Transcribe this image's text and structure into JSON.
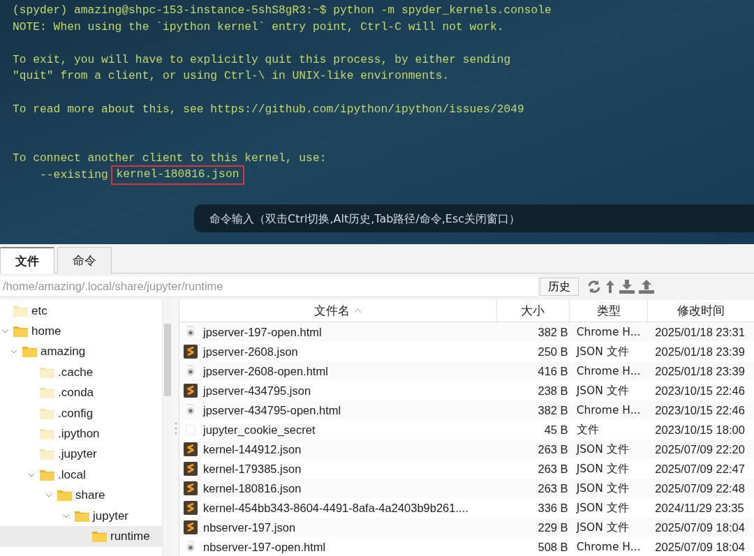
{
  "terminal": {
    "lines": [
      {
        "kind": "text",
        "text": "(spyder) amazing@shpc-153-instance-5shS8gR3:~$ python -m spyder_kernels.console"
      },
      {
        "kind": "text",
        "text": "NOTE: When using the `ipython kernel` entry point, Ctrl-C will not work."
      },
      {
        "kind": "blank"
      },
      {
        "kind": "text",
        "text": "To exit, you will have to explicitly quit this process, by either sending"
      },
      {
        "kind": "text",
        "text": "\"quit\" from a client, or using Ctrl-\\ in UNIX-like environments."
      },
      {
        "kind": "blank"
      },
      {
        "kind": "text",
        "text": "To read more about this, see https://github.com/ipython/ipython/issues/2049"
      },
      {
        "kind": "blank"
      },
      {
        "kind": "blank"
      },
      {
        "kind": "text",
        "text": "To connect another client to this kernel, use:"
      },
      {
        "kind": "text",
        "text": "    --existing ",
        "boxed": "kernel-180816.json"
      }
    ],
    "command_bar": {
      "placeholder": "命令输入（双击Ctrl切换,Alt历史,Tab路径/命令,Esc关闭窗口）"
    }
  },
  "tabs": [
    {
      "label": "文件",
      "selected": true
    },
    {
      "label": "命令",
      "selected": false
    }
  ],
  "path_bar": {
    "path": "/home/amazing/.local/share/jupyter/runtime",
    "history_button": "历史"
  },
  "tree": {
    "items": [
      {
        "label": "etc",
        "expanded": false,
        "selected": false
      },
      {
        "label": "home",
        "expanded": true,
        "selected": false,
        "children": [
          {
            "label": "amazing",
            "expanded": true,
            "selected": false,
            "children": [
              {
                "label": ".cache",
                "expanded": false,
                "selected": false
              },
              {
                "label": ".conda",
                "expanded": false,
                "selected": false
              },
              {
                "label": ".config",
                "expanded": false,
                "selected": false
              },
              {
                "label": ".ipython",
                "expanded": false,
                "selected": false
              },
              {
                "label": ".jupyter",
                "expanded": false,
                "selected": false
              },
              {
                "label": ".local",
                "expanded": true,
                "selected": false,
                "children": [
                  {
                    "label": "share",
                    "expanded": true,
                    "selected": false,
                    "children": [
                      {
                        "label": "jupyter",
                        "expanded": true,
                        "selected": false,
                        "children": [
                          {
                            "label": "runtime",
                            "expanded": false,
                            "selected": true
                          }
                        ]
                      }
                    ]
                  }
                ]
              }
            ]
          }
        ]
      }
    ]
  },
  "table": {
    "columns": [
      {
        "label": "文件名",
        "sorted": true
      },
      {
        "label": "大小",
        "sorted": false
      },
      {
        "label": "类型",
        "sorted": false
      },
      {
        "label": "修改时间",
        "sorted": false
      }
    ],
    "rows": [
      {
        "kind": "html",
        "name": "jpserver-197-open.html",
        "size": "382 B",
        "type": "Chrome H...",
        "modified": "2025/01/18 23:31"
      },
      {
        "kind": "json",
        "name": "jpserver-2608.json",
        "size": "250 B",
        "type": "JSON 文件",
        "modified": "2025/01/18 23:39"
      },
      {
        "kind": "html",
        "name": "jpserver-2608-open.html",
        "size": "416 B",
        "type": "Chrome H...",
        "modified": "2025/01/18 23:39"
      },
      {
        "kind": "json",
        "name": "jpserver-434795.json",
        "size": "238 B",
        "type": "JSON 文件",
        "modified": "2023/10/15 22:46"
      },
      {
        "kind": "html",
        "name": "jpserver-434795-open.html",
        "size": "382 B",
        "type": "Chrome H...",
        "modified": "2023/10/15 22:46"
      },
      {
        "kind": "file",
        "name": "jupyter_cookie_secret",
        "size": "45 B",
        "type": "文件",
        "modified": "2023/10/15 18:00"
      },
      {
        "kind": "json",
        "name": "kernel-144912.json",
        "size": "263 B",
        "type": "JSON 文件",
        "modified": "2025/07/09 22:20"
      },
      {
        "kind": "json",
        "name": "kernel-179385.json",
        "size": "263 B",
        "type": "JSON 文件",
        "modified": "2025/07/09 22:47"
      },
      {
        "kind": "json",
        "name": "kernel-180816.json",
        "size": "263 B",
        "type": "JSON 文件",
        "modified": "2025/07/09 22:48"
      },
      {
        "kind": "json",
        "name": "kernel-454bb343-8604-4491-8afa-4a2403b9b261....",
        "size": "336 B",
        "type": "JSON 文件",
        "modified": "2024/11/29 23:35"
      },
      {
        "kind": "json",
        "name": "nbserver-197.json",
        "size": "229 B",
        "type": "JSON 文件",
        "modified": "2025/07/09 18:04"
      },
      {
        "kind": "html",
        "name": "nbserver-197-open.html",
        "size": "508 B",
        "type": "Chrome H...",
        "modified": "2025/07/09 18:04"
      }
    ]
  }
}
